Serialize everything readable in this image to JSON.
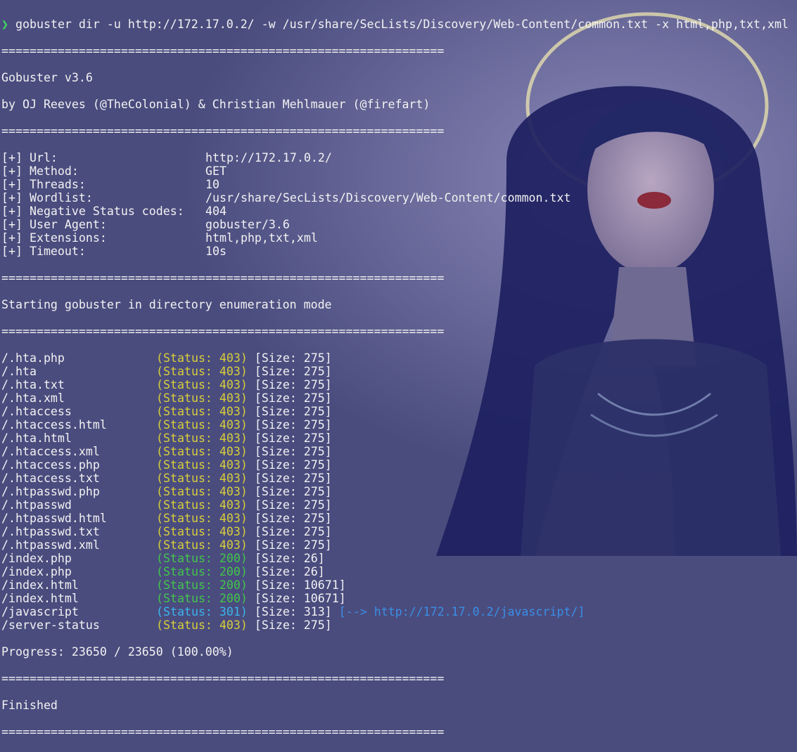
{
  "prompt": {
    "symbol": "❯",
    "command": "gobuster dir -u http://172.17.0.2/ -w /usr/share/SecLists/Discovery/Web-Content/common.txt -x html,php,txt,xml"
  },
  "separator": "===============================================================",
  "banner": {
    "version": "Gobuster v3.6",
    "authors": "by OJ Reeves (@TheColonial) & Christian Mehlmauer (@firefart)"
  },
  "config": [
    {
      "key": "[+] Url:",
      "value": "http://172.17.0.2/"
    },
    {
      "key": "[+] Method:",
      "value": "GET"
    },
    {
      "key": "[+] Threads:",
      "value": "10"
    },
    {
      "key": "[+] Wordlist:",
      "value": "/usr/share/SecLists/Discovery/Web-Content/common.txt"
    },
    {
      "key": "[+] Negative Status codes:",
      "value": "404"
    },
    {
      "key": "[+] User Agent:",
      "value": "gobuster/3.6"
    },
    {
      "key": "[+] Extensions:",
      "value": "html,php,txt,xml"
    },
    {
      "key": "[+] Timeout:",
      "value": "10s"
    }
  ],
  "start_message": "Starting gobuster in directory enumeration mode",
  "results": [
    {
      "path": "/.hta.php",
      "status": "(Status: 403)",
      "code": "403",
      "size": "[Size: 275]",
      "redirect": ""
    },
    {
      "path": "/.hta",
      "status": "(Status: 403)",
      "code": "403",
      "size": "[Size: 275]",
      "redirect": ""
    },
    {
      "path": "/.hta.txt",
      "status": "(Status: 403)",
      "code": "403",
      "size": "[Size: 275]",
      "redirect": ""
    },
    {
      "path": "/.hta.xml",
      "status": "(Status: 403)",
      "code": "403",
      "size": "[Size: 275]",
      "redirect": ""
    },
    {
      "path": "/.htaccess",
      "status": "(Status: 403)",
      "code": "403",
      "size": "[Size: 275]",
      "redirect": ""
    },
    {
      "path": "/.htaccess.html",
      "status": "(Status: 403)",
      "code": "403",
      "size": "[Size: 275]",
      "redirect": ""
    },
    {
      "path": "/.hta.html",
      "status": "(Status: 403)",
      "code": "403",
      "size": "[Size: 275]",
      "redirect": ""
    },
    {
      "path": "/.htaccess.xml",
      "status": "(Status: 403)",
      "code": "403",
      "size": "[Size: 275]",
      "redirect": ""
    },
    {
      "path": "/.htaccess.php",
      "status": "(Status: 403)",
      "code": "403",
      "size": "[Size: 275]",
      "redirect": ""
    },
    {
      "path": "/.htaccess.txt",
      "status": "(Status: 403)",
      "code": "403",
      "size": "[Size: 275]",
      "redirect": ""
    },
    {
      "path": "/.htpasswd.php",
      "status": "(Status: 403)",
      "code": "403",
      "size": "[Size: 275]",
      "redirect": ""
    },
    {
      "path": "/.htpasswd",
      "status": "(Status: 403)",
      "code": "403",
      "size": "[Size: 275]",
      "redirect": ""
    },
    {
      "path": "/.htpasswd.html",
      "status": "(Status: 403)",
      "code": "403",
      "size": "[Size: 275]",
      "redirect": ""
    },
    {
      "path": "/.htpasswd.txt",
      "status": "(Status: 403)",
      "code": "403",
      "size": "[Size: 275]",
      "redirect": ""
    },
    {
      "path": "/.htpasswd.xml",
      "status": "(Status: 403)",
      "code": "403",
      "size": "[Size: 275]",
      "redirect": ""
    },
    {
      "path": "/index.php",
      "status": "(Status: 200)",
      "code": "200",
      "size": "[Size: 26]",
      "redirect": ""
    },
    {
      "path": "/index.php",
      "status": "(Status: 200)",
      "code": "200",
      "size": "[Size: 26]",
      "redirect": ""
    },
    {
      "path": "/index.html",
      "status": "(Status: 200)",
      "code": "200",
      "size": "[Size: 10671]",
      "redirect": ""
    },
    {
      "path": "/index.html",
      "status": "(Status: 200)",
      "code": "200",
      "size": "[Size: 10671]",
      "redirect": ""
    },
    {
      "path": "/javascript",
      "status": "(Status: 301)",
      "code": "301",
      "size": "[Size: 313]",
      "redirect": "[--> http://172.17.0.2/javascript/]"
    },
    {
      "path": "/server-status",
      "status": "(Status: 403)",
      "code": "403",
      "size": "[Size: 275]",
      "redirect": ""
    }
  ],
  "progress": "Progress: 23650 / 23650 (100.00%)",
  "finished": "Finished",
  "colors": {
    "status_403": "#d8cf3a",
    "status_200": "#42c748",
    "status_301": "#3ab6ea",
    "redirect": "#3b8ee6",
    "prompt": "#3ddc5c"
  }
}
